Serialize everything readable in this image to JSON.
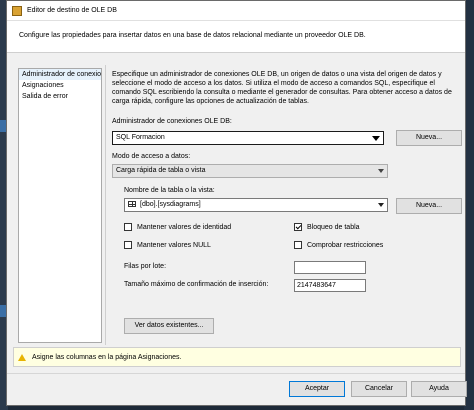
{
  "window": {
    "title": "Editor de destino de OLE DB"
  },
  "header": {
    "description": "Configure las propiedades para insertar datos en una base de datos relacional mediante un proveedor OLE DB."
  },
  "nav": {
    "items": [
      "Administrador de conexiones",
      "Asignaciones",
      "Salida de error"
    ]
  },
  "content": {
    "info": "Especifique un administrador de conexiones OLE DB, un origen de datos o una vista del origen de datos y seleccione el modo de acceso a los datos. Si utiliza el modo de acceso a comandos SQL, especifique el comando SQL escribiendo la consulta o mediante el generador de consultas. Para obtener acceso a datos de carga rápida, configure las opciones de actualización de tablas.",
    "conn_label": "Administrador de conexiones OLE DB:",
    "conn_value": "SQL Formacion",
    "new_button": "Nueva...",
    "mode_label": "Modo de acceso a datos:",
    "mode_value": "Carga rápida de tabla o vista",
    "table_label": "Nombre de la tabla o la vista:",
    "table_value": "[dbo].[sysdiagrams]",
    "new_button2": "Nueva...",
    "keep_identity": "Mantener valores de identidad",
    "keep_identity_checked": false,
    "table_lock": "Bloqueo de tabla",
    "table_lock_checked": true,
    "keep_nulls": "Mantener valores NULL",
    "keep_nulls_checked": false,
    "check_constraints": "Comprobar restricciones",
    "check_constraints_checked": false,
    "rows_per_batch_label": "Filas por lote:",
    "rows_per_batch_value": "",
    "max_commit_label": "Tamaño máximo de confirmación de inserción:",
    "max_commit_value": "2147483647",
    "view_existing": "Ver datos existentes..."
  },
  "message": {
    "text": "Asigne las columnas en la página Asignaciones."
  },
  "footer": {
    "accept": "Aceptar",
    "cancel": "Cancelar",
    "help": "Ayuda"
  },
  "colors": {
    "accent": "#0078d7",
    "warning_bg": "#ffffe1",
    "warning_icon": "#e8b400"
  },
  "icons": {
    "warning": "warning-icon",
    "table": "table-icon"
  }
}
